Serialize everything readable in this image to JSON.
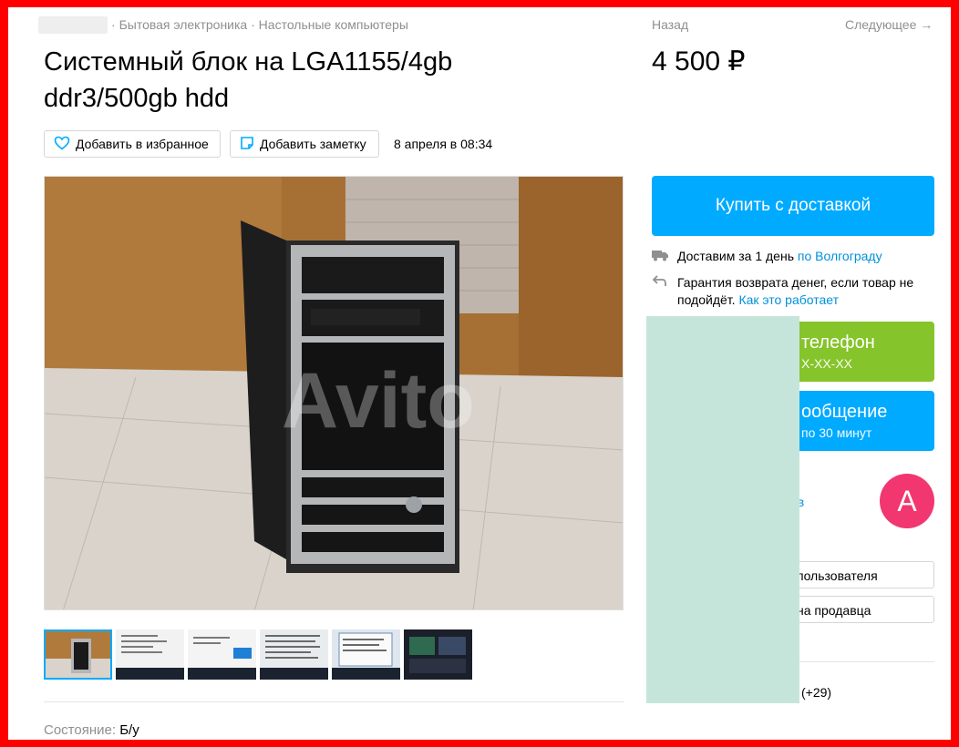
{
  "breadcrumbs": {
    "items": [
      "Бытовая электроника",
      "Настольные компьютеры"
    ],
    "separator": "·"
  },
  "nav": {
    "back": "Назад",
    "next": "Следующее →"
  },
  "listing": {
    "title": "Системный блок на LGA1155/4gb ddr3/500gb hdd",
    "price": "4 500 ₽",
    "date": "8 апреля в 08:34",
    "condition_label": "Состояние:",
    "condition_value": "Б/у"
  },
  "actions": {
    "favorite": "Добавить в избранное",
    "note": "Добавить заметку"
  },
  "gallery": {
    "watermark": "Avito",
    "thumbnail_count": 6,
    "active_index": 0
  },
  "purchase": {
    "buy_button": "Купить с доставкой",
    "delivery_text": "Доставим за 1 день",
    "delivery_link": "по Волгограду",
    "guarantee_text": "Гарантия возврата денег, если товар не подойдёт.",
    "guarantee_link": "Как это работает"
  },
  "contact": {
    "phone_title": "телефон",
    "phone_sub": "X-XX-XX",
    "message_title": "ообщение",
    "message_sub": "по 30 минут"
  },
  "seller": {
    "avatar_letter": "А",
    "link_fragment": "ов",
    "btn_user": "пользователя",
    "btn_seller": "на продавца",
    "extra": "(+29)"
  },
  "colors": {
    "accent": "#00aaff",
    "green": "#85c42a",
    "avatar": "#f2366f",
    "link": "#0091d9",
    "frame": "#ff0000",
    "mask": "#c6e5da"
  }
}
